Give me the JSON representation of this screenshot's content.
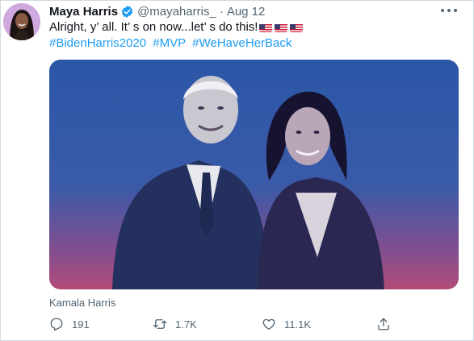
{
  "author": {
    "name": "Maya Harris",
    "handle": "@mayaharris_",
    "date": "Aug 12",
    "separator": "·"
  },
  "tweet": {
    "text": "Alright, y’ all. It’ s on now...let’ s do this!",
    "hashtags": [
      "#BidenHarris2020",
      "#MVP",
      "#WeHaveHerBack"
    ],
    "media_caption": "Kamala Harris"
  },
  "stats": {
    "replies": "191",
    "retweets": "1.7K",
    "likes": "11.1K"
  },
  "icons": {
    "verified": "verified-badge-icon",
    "more": "more-options-icon",
    "reply": "reply-icon",
    "retweet": "retweet-icon",
    "like": "heart-icon",
    "share": "share-icon"
  },
  "colors": {
    "accent": "#1d9bf0",
    "muted": "#536471",
    "text": "#0f1419",
    "media_top": "#2a56a6",
    "media_bottom": "#b24c79"
  }
}
